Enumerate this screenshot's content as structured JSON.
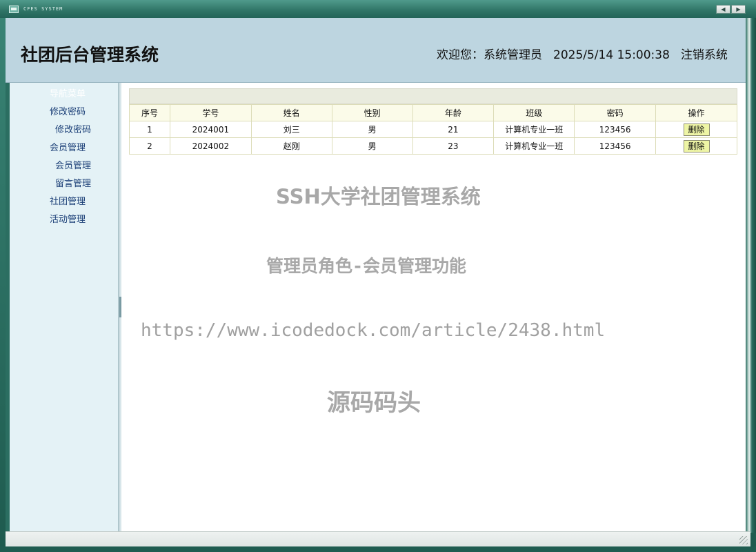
{
  "window": {
    "title": "CFES SYSTEM",
    "prev_icon": "◀",
    "next_icon": "▶"
  },
  "header": {
    "title": "社团后台管理系统",
    "welcome": "欢迎您：系统管理员",
    "datetime": "2025/5/14 15:00:38",
    "logout": "注销系统"
  },
  "sidebar": {
    "menu_title": "导航菜单",
    "items": [
      {
        "label": "修改密码",
        "level": 1
      },
      {
        "label": "修改密码",
        "level": 2
      },
      {
        "label": "会员管理",
        "level": 1
      },
      {
        "label": "会员管理",
        "level": 2
      },
      {
        "label": "留言管理",
        "level": 2
      },
      {
        "label": "社团管理",
        "level": 1
      },
      {
        "label": "活动管理",
        "level": 1
      }
    ]
  },
  "table": {
    "columns": [
      "序号",
      "学号",
      "姓名",
      "性别",
      "年龄",
      "班级",
      "密码",
      "操作"
    ],
    "rows": [
      {
        "seq": "1",
        "student_id": "2024001",
        "name": "刘三",
        "gender": "男",
        "age": "21",
        "class": "计算机专业一班",
        "password": "123456",
        "action": "删除"
      },
      {
        "seq": "2",
        "student_id": "2024002",
        "name": "赵刚",
        "gender": "男",
        "age": "23",
        "class": "计算机专业一班",
        "password": "123456",
        "action": "删除"
      }
    ]
  },
  "watermarks": {
    "line1": "SSH大学社团管理系统",
    "line2": "管理员角色-会员管理功能",
    "line3": "https://www.icodedock.com/article/2438.html",
    "line4": "源码码头"
  }
}
